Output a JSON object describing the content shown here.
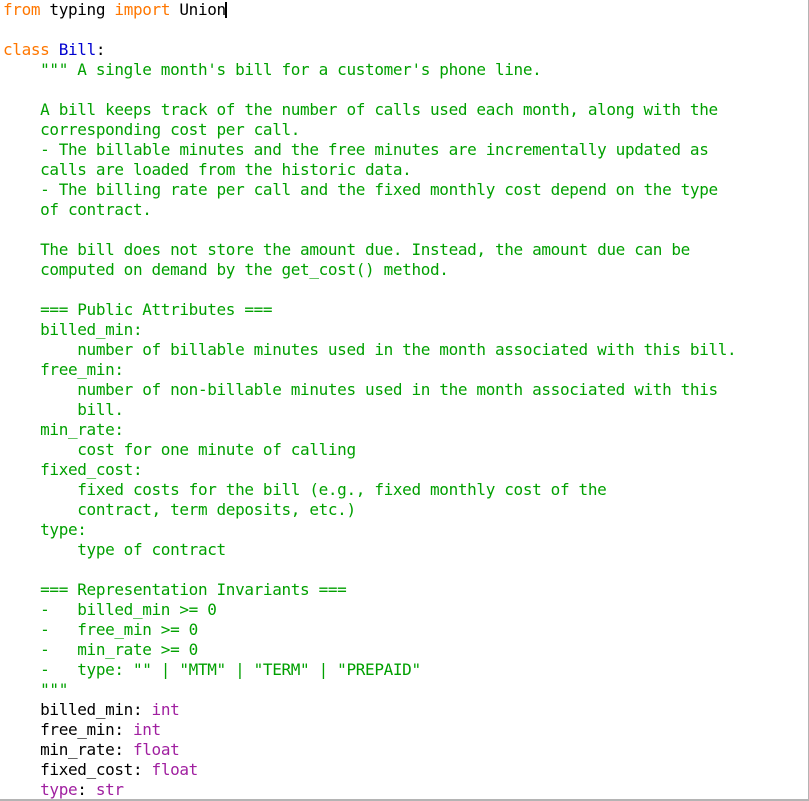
{
  "window": {
    "app": "Python editor",
    "language": "Python"
  },
  "colors": {
    "background": "#ffffff",
    "foreground": "#000000",
    "keyword": "#ff7700",
    "class_name": "#0000d0",
    "string": "#00a000",
    "builtin": "#a020a0",
    "border": "#b4b4b4"
  },
  "editor": {
    "caret_after_text": "Union",
    "caret_line": 1,
    "lines": [
      {
        "n": 1,
        "segments": [
          {
            "t": "from",
            "c": "kw"
          },
          {
            "t": " typing ",
            "c": "plain"
          },
          {
            "t": "import",
            "c": "kw"
          },
          {
            "t": " Union",
            "c": "plain"
          }
        ],
        "caret": true
      },
      {
        "n": 2,
        "segments": []
      },
      {
        "n": 3,
        "segments": [
          {
            "t": "class",
            "c": "kw"
          },
          {
            "t": " ",
            "c": "plain"
          },
          {
            "t": "Bill",
            "c": "cls"
          },
          {
            "t": ":",
            "c": "plain"
          }
        ]
      },
      {
        "n": 4,
        "segments": [
          {
            "t": "    \"\"\" A single month's bill for a customer's phone line.",
            "c": "str"
          }
        ]
      },
      {
        "n": 5,
        "segments": [
          {
            "t": "",
            "c": "str"
          }
        ]
      },
      {
        "n": 6,
        "segments": [
          {
            "t": "    A bill keeps track of the number of calls used each month, along with the",
            "c": "str"
          }
        ]
      },
      {
        "n": 7,
        "segments": [
          {
            "t": "    corresponding cost per call.",
            "c": "str"
          }
        ]
      },
      {
        "n": 8,
        "segments": [
          {
            "t": "    - The billable minutes and the free minutes are incrementally updated as",
            "c": "str"
          }
        ]
      },
      {
        "n": 9,
        "segments": [
          {
            "t": "    calls are loaded from the historic data.",
            "c": "str"
          }
        ]
      },
      {
        "n": 10,
        "segments": [
          {
            "t": "    - The billing rate per call and the fixed monthly cost depend on the type",
            "c": "str"
          }
        ]
      },
      {
        "n": 11,
        "segments": [
          {
            "t": "    of contract.",
            "c": "str"
          }
        ]
      },
      {
        "n": 12,
        "segments": [
          {
            "t": "",
            "c": "str"
          }
        ]
      },
      {
        "n": 13,
        "segments": [
          {
            "t": "    The bill does not store the amount due. Instead, the amount due can be",
            "c": "str"
          }
        ]
      },
      {
        "n": 14,
        "segments": [
          {
            "t": "    computed on demand by the get_cost() method.",
            "c": "str"
          }
        ]
      },
      {
        "n": 15,
        "segments": [
          {
            "t": "",
            "c": "str"
          }
        ]
      },
      {
        "n": 16,
        "segments": [
          {
            "t": "    === Public Attributes ===",
            "c": "str"
          }
        ]
      },
      {
        "n": 17,
        "segments": [
          {
            "t": "    billed_min:",
            "c": "str"
          }
        ]
      },
      {
        "n": 18,
        "segments": [
          {
            "t": "        number of billable minutes used in the month associated with this bill.",
            "c": "str"
          }
        ]
      },
      {
        "n": 19,
        "segments": [
          {
            "t": "    free_min:",
            "c": "str"
          }
        ]
      },
      {
        "n": 20,
        "segments": [
          {
            "t": "        number of non-billable minutes used in the month associated with this",
            "c": "str"
          }
        ]
      },
      {
        "n": 21,
        "segments": [
          {
            "t": "        bill.",
            "c": "str"
          }
        ]
      },
      {
        "n": 22,
        "segments": [
          {
            "t": "    min_rate:",
            "c": "str"
          }
        ]
      },
      {
        "n": 23,
        "segments": [
          {
            "t": "        cost for one minute of calling",
            "c": "str"
          }
        ]
      },
      {
        "n": 24,
        "segments": [
          {
            "t": "    fixed_cost:",
            "c": "str"
          }
        ]
      },
      {
        "n": 25,
        "segments": [
          {
            "t": "        fixed costs for the bill (e.g., fixed monthly cost of the",
            "c": "str"
          }
        ]
      },
      {
        "n": 26,
        "segments": [
          {
            "t": "        contract, term deposits, etc.)",
            "c": "str"
          }
        ]
      },
      {
        "n": 27,
        "segments": [
          {
            "t": "    type:",
            "c": "str"
          }
        ]
      },
      {
        "n": 28,
        "segments": [
          {
            "t": "        type of contract",
            "c": "str"
          }
        ]
      },
      {
        "n": 29,
        "segments": [
          {
            "t": "",
            "c": "str"
          }
        ]
      },
      {
        "n": 30,
        "segments": [
          {
            "t": "    === Representation Invariants ===",
            "c": "str"
          }
        ]
      },
      {
        "n": 31,
        "segments": [
          {
            "t": "    -   billed_min >= 0",
            "c": "str"
          }
        ]
      },
      {
        "n": 32,
        "segments": [
          {
            "t": "    -   free_min >= 0",
            "c": "str"
          }
        ]
      },
      {
        "n": 33,
        "segments": [
          {
            "t": "    -   min_rate >= 0",
            "c": "str"
          }
        ]
      },
      {
        "n": 34,
        "segments": [
          {
            "t": "    -   type: \"\" | \"MTM\" | \"TERM\" | \"PREPAID\"",
            "c": "str"
          }
        ]
      },
      {
        "n": 35,
        "segments": [
          {
            "t": "    \"\"\"",
            "c": "str"
          }
        ]
      },
      {
        "n": 36,
        "segments": [
          {
            "t": "    billed_min: ",
            "c": "plain"
          },
          {
            "t": "int",
            "c": "bi"
          }
        ]
      },
      {
        "n": 37,
        "segments": [
          {
            "t": "    free_min: ",
            "c": "plain"
          },
          {
            "t": "int",
            "c": "bi"
          }
        ]
      },
      {
        "n": 38,
        "segments": [
          {
            "t": "    min_rate: ",
            "c": "plain"
          },
          {
            "t": "float",
            "c": "bi"
          }
        ]
      },
      {
        "n": 39,
        "segments": [
          {
            "t": "    fixed_cost: ",
            "c": "plain"
          },
          {
            "t": "float",
            "c": "bi"
          }
        ]
      },
      {
        "n": 40,
        "segments": [
          {
            "t": "    ",
            "c": "plain"
          },
          {
            "t": "type",
            "c": "bi"
          },
          {
            "t": ": ",
            "c": "plain"
          },
          {
            "t": "str",
            "c": "bi"
          }
        ]
      }
    ]
  }
}
